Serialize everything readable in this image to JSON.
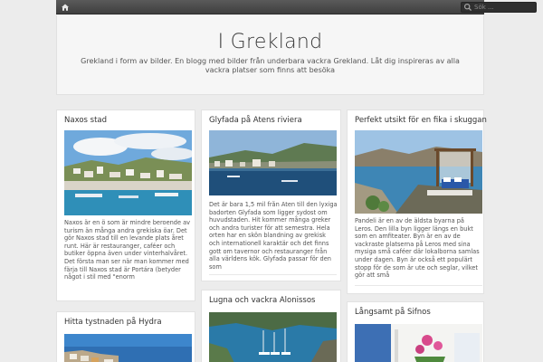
{
  "nav": {
    "home_icon": "home-icon",
    "search_icon": "search-icon",
    "search_placeholder": "Sök ..."
  },
  "header": {
    "title": "I Grekland",
    "description": "Grekland i form av bilder. En blogg med bilder från underbara vackra Grekland. Låt dig inspireras av alla vackra platser som finns att besöka"
  },
  "posts": [
    {
      "title": "Naxos stad",
      "excerpt": "Naxos är en ö som är mindre beroende av turism än många andra grekiska öar. Det gör Naxos stad till en levande plats året runt. Här är restauranger, caféer och butiker öppna även under vinterhalvåret. Det första man ser när man kommer med färja till Naxos stad är Portára (betyder något i stil med \"enorm"
    },
    {
      "title": "Glyfada på Atens riviera",
      "excerpt": "Det är bara 1,5 mil från Aten till den lyxiga badorten Glyfada som ligger sydost om huvudstaden. Hit kommer många greker och andra turister för att semestra. Hela orten har en skön blandning av grekisk och internationell karaktär och det finns gott om tavernor och restauranger från alla världens kök. Glyfada passar för den som"
    },
    {
      "title": "Perfekt utsikt för en fika i skuggan",
      "excerpt": "Pandeli är en av de äldsta byarna på Leros. Den lilla byn ligger längs en bukt som en amfiteater. Byn är en av de vackraste platserna på Leros med sina mysiga små caféer där lokalborna samlas under dagen. Byn är också ett populärt stopp för de som är ute och seglar, vilket gör att små"
    },
    {
      "title": "Hitta tystnaden på Hydra"
    },
    {
      "title": "Lugna och vackra Alonissos"
    },
    {
      "title": "Långsamt på Sifnos"
    }
  ]
}
